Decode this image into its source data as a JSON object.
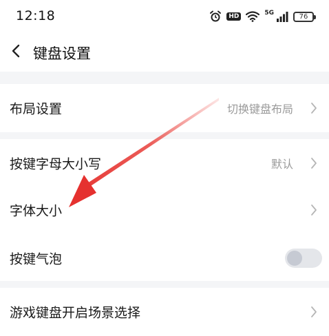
{
  "status_bar": {
    "time": "12:18",
    "network_label": "5G",
    "hd_label": "HD",
    "battery": "76",
    "icons": [
      "alarm-icon",
      "hd-icon",
      "wifi-icon",
      "signal-icon",
      "battery-icon"
    ]
  },
  "header": {
    "title": "键盘设置",
    "back_icon": "chevron-left-icon"
  },
  "settings": {
    "layout": {
      "label": "布局设置",
      "value": "切换键盘布局"
    },
    "case": {
      "label": "按键字母大小写",
      "value": "默认"
    },
    "font_size": {
      "label": "字体大小"
    },
    "bubble": {
      "label": "按键气泡",
      "enabled": false
    },
    "game": {
      "label": "游戏键盘开启场景选择"
    }
  },
  "colors": {
    "accent_arrow": "#e5312f",
    "section_gap": "#f4f5f7",
    "secondary_text": "#9a9a9a",
    "toggle_off": "#e4e6ea"
  }
}
